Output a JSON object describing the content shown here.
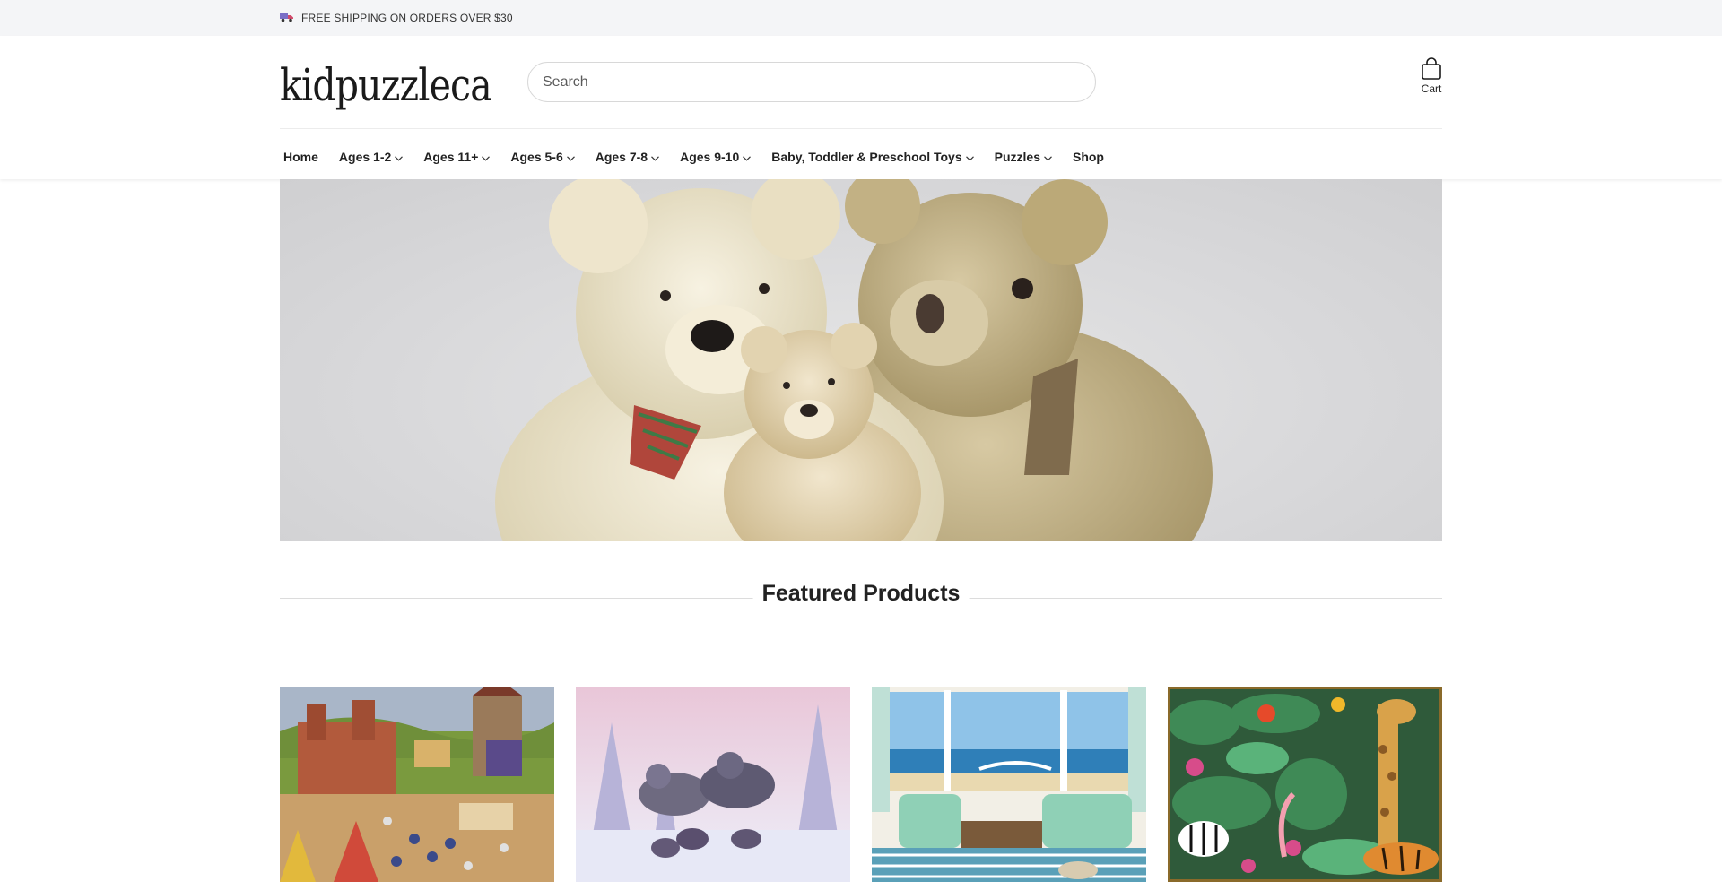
{
  "announcement": {
    "text": "FREE SHIPPING ON ORDERS OVER $30",
    "icon": "truck-icon"
  },
  "header": {
    "logo": "kidpuzzleca",
    "search": {
      "placeholder": "Search",
      "value": ""
    },
    "cart": {
      "label": "Cart",
      "icon": "shopping-bag-icon"
    }
  },
  "nav": {
    "items": [
      {
        "label": "Home",
        "has_dropdown": false
      },
      {
        "label": "Ages 1-2",
        "has_dropdown": true
      },
      {
        "label": "Ages 11+",
        "has_dropdown": true
      },
      {
        "label": "Ages 5-6",
        "has_dropdown": true
      },
      {
        "label": "Ages 7-8",
        "has_dropdown": true
      },
      {
        "label": "Ages 9-10",
        "has_dropdown": true
      },
      {
        "label": "Baby, Toddler & Preschool Toys",
        "has_dropdown": true
      },
      {
        "label": "Puzzles",
        "has_dropdown": true
      },
      {
        "label": "Shop",
        "has_dropdown": false
      }
    ]
  },
  "hero": {
    "image": "teddy-bears-banner"
  },
  "featured": {
    "title": "Featured Products",
    "products": [
      {
        "image": "medieval-castle-puzzle"
      },
      {
        "image": "winter-wolves-puzzle"
      },
      {
        "image": "beach-living-room-puzzle"
      },
      {
        "image": "jungle-animals-puzzle"
      }
    ]
  },
  "colors": {
    "announcement_bg": "#f4f5f7",
    "text": "#1f1f1f",
    "divider": "#dcdcdc"
  }
}
